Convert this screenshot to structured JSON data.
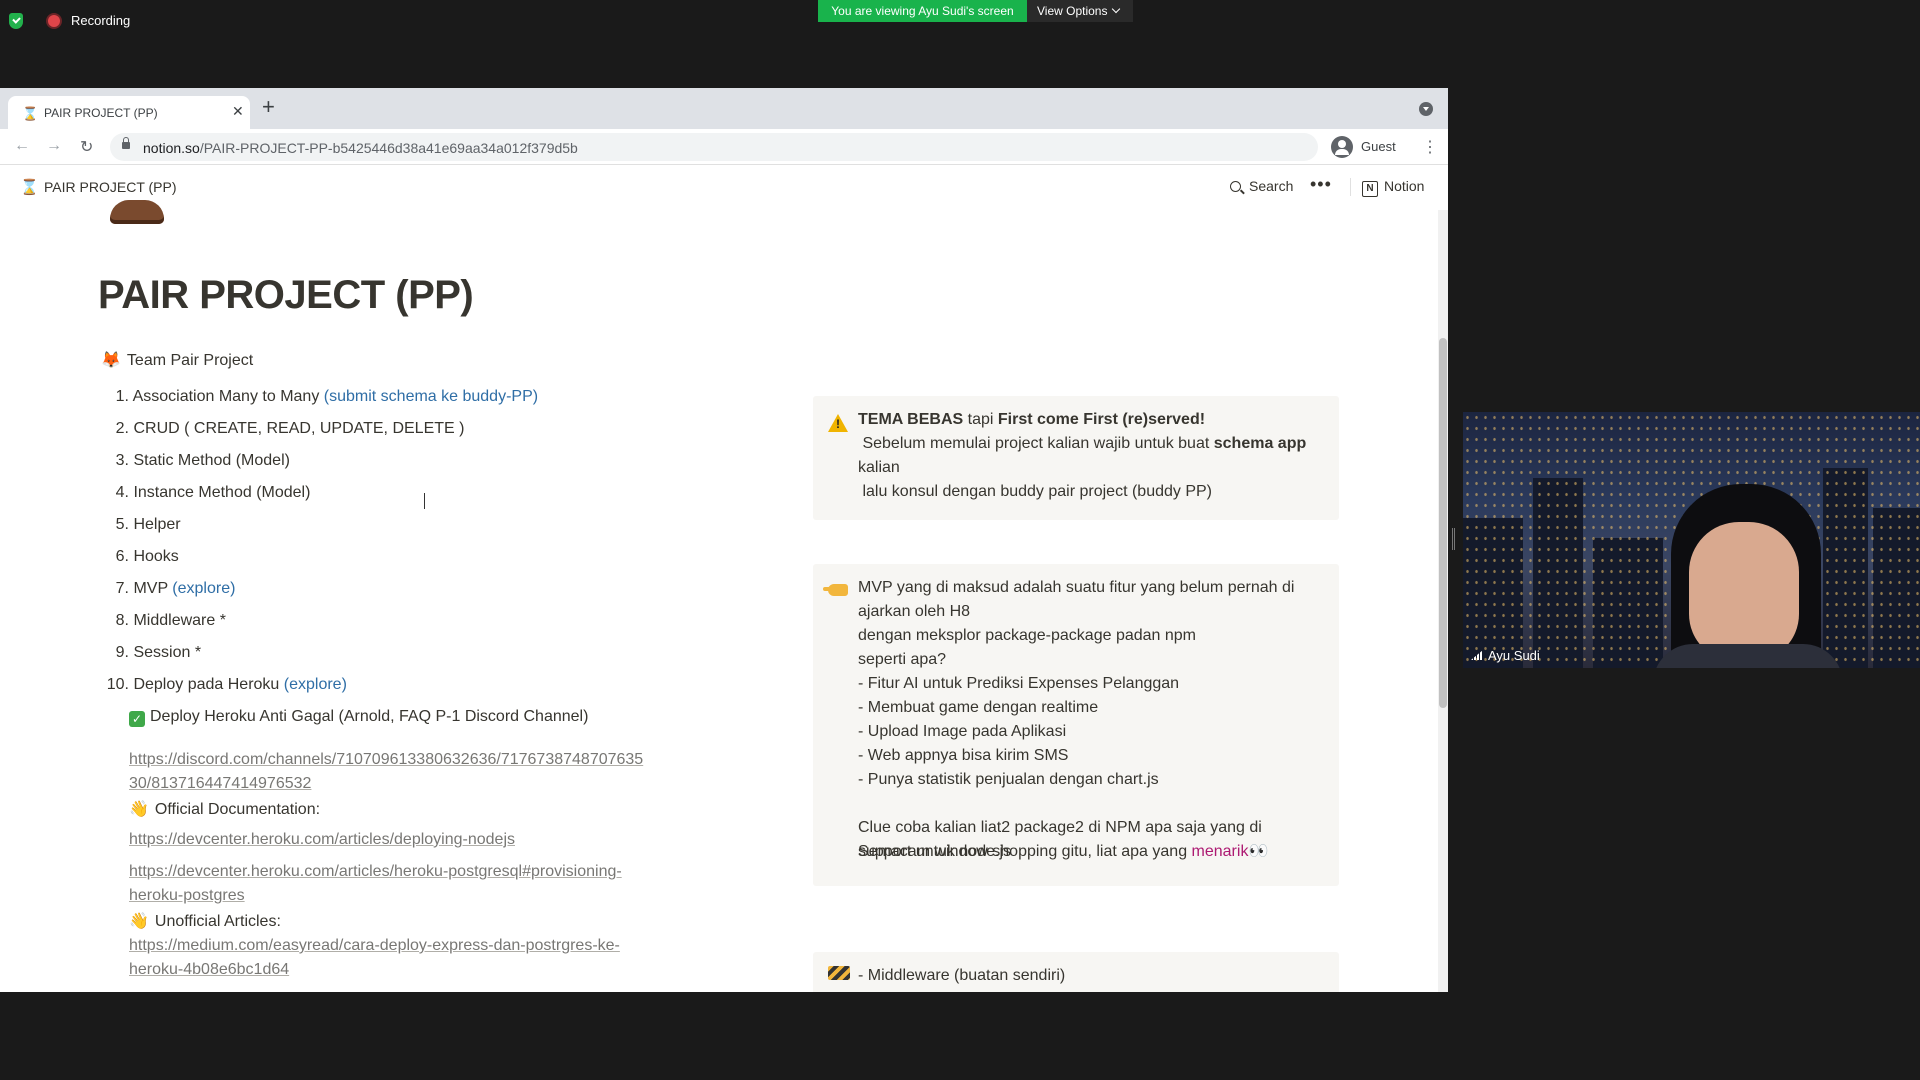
{
  "zoom": {
    "recording_label": "Recording",
    "viewing_banner": "You are viewing Ayu Sudi's screen",
    "view_options_label": "View Options"
  },
  "browser": {
    "tab_title": "PAIR PROJECT (PP)",
    "url_domain": "notion.so",
    "url_path": "/PAIR-PROJECT-PP-b5425446d38a41e69aa34a012f379d5b",
    "profile_label": "Guest"
  },
  "notion": {
    "header_title": "PAIR PROJECT (PP)",
    "search_label": "Search",
    "notion_label": "Notion",
    "page_title": "PAIR PROJECT (PP)",
    "team_line": "Team Pair Project",
    "list": [
      {
        "num": "1.",
        "text": "Association Many to Many ",
        "link": "(submit schema ke buddy-PP)"
      },
      {
        "num": "2.",
        "text": "CRUD ( CREATE, READ, UPDATE, DELETE )",
        "link": ""
      },
      {
        "num": "3.",
        "text": "Static Method (Model)",
        "link": ""
      },
      {
        "num": "4.",
        "text": "Instance Method (Model)",
        "link": ""
      },
      {
        "num": "5.",
        "text": "Helper",
        "link": ""
      },
      {
        "num": "6.",
        "text": "Hooks",
        "link": ""
      },
      {
        "num": "7.",
        "text": "MVP ",
        "link": "(explore)"
      },
      {
        "num": "8.",
        "text": "Middleware  *",
        "link": ""
      },
      {
        "num": "9.",
        "text": "Session *",
        "link": ""
      },
      {
        "num": "10.",
        "text": "Deploy pada Heroku ",
        "link": "(explore)"
      }
    ],
    "deploy_sub": {
      "anti_gagal": "Deploy Heroku Anti Gagal (Arnold, FAQ P-1 Discord Channel)",
      "discord_link": "https://discord.com/channels/710709613380632636/7176738748707635\n30/813716447414976532",
      "official_label": "Official Documentation:",
      "official_link_1": "https://devcenter.heroku.com/articles/deploying-nodejs",
      "official_link_2": "https://devcenter.heroku.com/articles/heroku-postgresql#provisioning-\nheroku-postgres",
      "unofficial_label": "Unofficial Articles:",
      "unofficial_link": "https://medium.com/easyread/cara-deploy-express-dan-postrgres-ke-\nheroku-4b08e6bc1d64"
    },
    "callout_1": {
      "bold_1": "TEMA BEBAS",
      "mid": " tapi ",
      "bold_2": "First come First (re)served!",
      "line2a": " Sebelum memulai project kalian wajib untuk buat ",
      "line2b": "schema app",
      "line3": "kalian",
      "line4": " lalu konsul dengan buddy pair project (buddy PP)"
    },
    "callout_2": {
      "lines": "MVP yang di maksud adalah suatu fitur yang belum pernah di\najarkan oleh H8\ndengan meksplor package-package padan npm\nseperti apa?\n- Fitur AI untuk Prediksi Expenses Pelanggan\n- Membuat game dengan realtime\n- Upload Image pada Aplikasi\n- Web appnya bisa kirim SMS\n- Punya statistik penjualan dengan chart.js\n\nClue coba kalian liat2 package2 di NPM apa saja yang di\nsupport untuk node.js",
      "last_line": "Semacam window shopping gitu, liat apa yang ",
      "last_highlight": "menarik",
      "eyes": "👀"
    },
    "callout_3": {
      "text": "- Middleware (buatan sendiri)"
    }
  },
  "video": {
    "participant_name": "Ayu Sudi"
  }
}
